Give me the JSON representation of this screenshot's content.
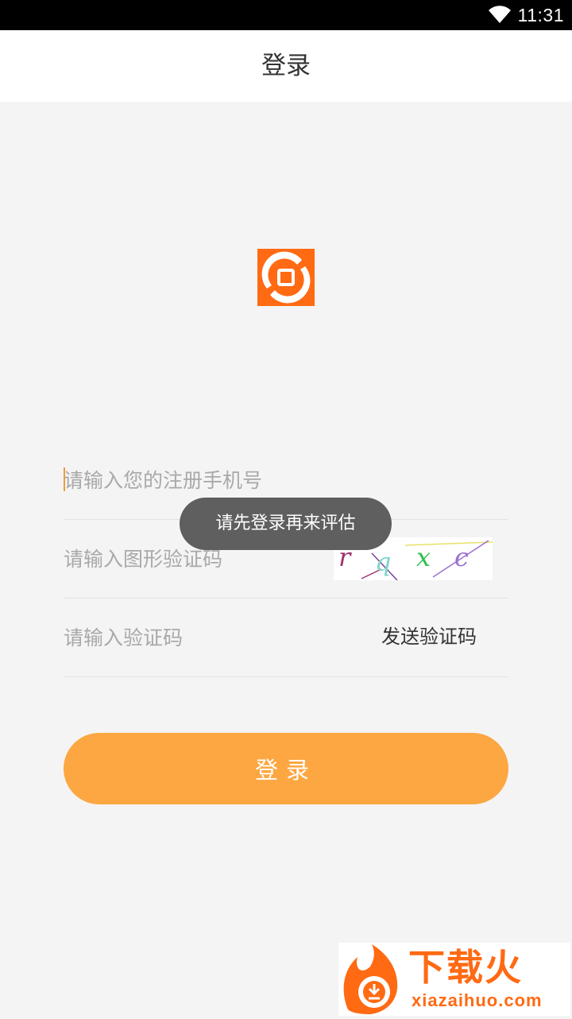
{
  "status_bar": {
    "time": "11:31",
    "icon": "wifi-icon"
  },
  "header": {
    "title": "登录"
  },
  "logo": {
    "icon": "app-logo-icon",
    "color": "#ff6a13"
  },
  "form": {
    "phone_placeholder": "请输入您的注册手机号",
    "captcha_placeholder": "请输入图形验证码",
    "captcha_text": "r q x c",
    "sms_placeholder": "请输入验证码",
    "send_code_label": "发送验证码",
    "login_label": "登录",
    "accent_color": "#fca741"
  },
  "toast": {
    "message": "请先登录再来评估"
  },
  "watermark": {
    "brand": "下载火",
    "domain": "xiazaihuo.com",
    "icon": "flame-logo-icon"
  }
}
